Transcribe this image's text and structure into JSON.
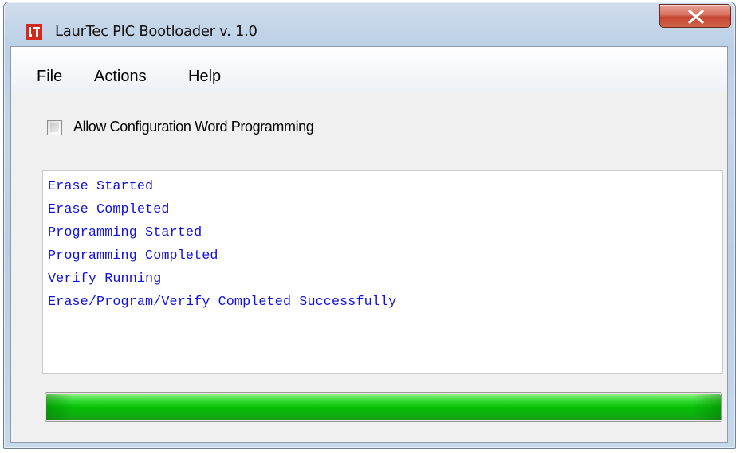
{
  "window": {
    "title": "LaurTec PIC Bootloader v. 1.0",
    "icon": "laurtec-logo-icon",
    "close_icon": "close-x-icon"
  },
  "menu": {
    "items": [
      {
        "label": "File"
      },
      {
        "label": "Actions"
      },
      {
        "label": "Help"
      }
    ]
  },
  "options": {
    "config_word_label": "Allow Configuration Word Programming",
    "config_word_checked": false
  },
  "log": {
    "lines": [
      "Erase Started",
      "Erase Completed",
      "Programming Started",
      "Programming Completed",
      "Verify Running",
      "Erase/Program/Verify Completed Successfully"
    ]
  },
  "progress": {
    "fraction": 1.0
  },
  "colors": {
    "log_text": "#1010e0",
    "progress_green": "#06c106",
    "logo_red": "#d42a1e"
  }
}
